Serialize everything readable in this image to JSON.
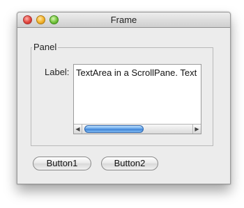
{
  "window": {
    "title": "Frame",
    "panel_title": "Panel",
    "field_label": "Label:",
    "textarea_text": "TextArea in a ScrollPane. Text",
    "scroll_left": "◀",
    "scroll_right": "▶",
    "buttons": [
      {
        "label": "Button1"
      },
      {
        "label": "Button2"
      }
    ]
  }
}
